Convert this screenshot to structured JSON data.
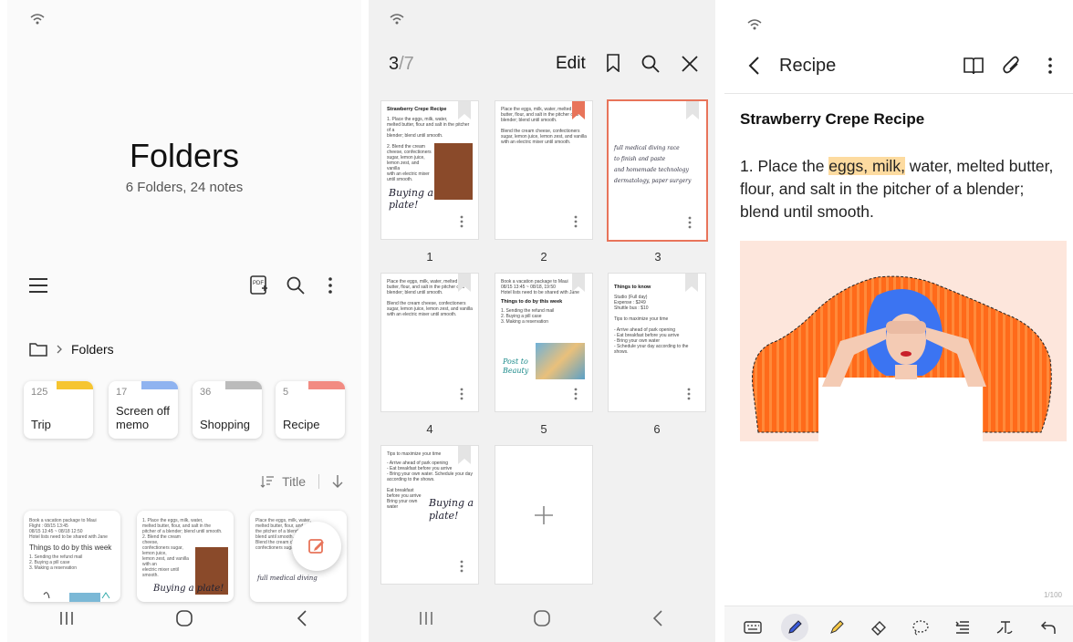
{
  "colors": {
    "accent": "#e8745a",
    "highlight": "#fddba0",
    "folder_trip": "#f6c531",
    "folder_screen_off": "#8fb3f0",
    "folder_shopping": "#bbbbbb",
    "folder_recipe": "#f28b82"
  },
  "folders_panel": {
    "title": "Folders",
    "subtitle": "6 Folders, 24 notes",
    "breadcrumb": "Folders",
    "folders": [
      {
        "count": "125",
        "name": "Trip"
      },
      {
        "count": "17",
        "name": "Screen off memo"
      },
      {
        "count": "36",
        "name": "Shopping"
      },
      {
        "count": "5",
        "name": "Recipe"
      }
    ],
    "sort_label": "Title",
    "notes": [
      {
        "lines": [
          "Book a vacation package to Maui",
          "Flight : 08/15 13:45",
          "08/15 13:45 ~ 08/18 12:50",
          "Hotel lists need to be shared with Jane"
        ],
        "heading": "Things to do by this week",
        "items": [
          "1. Sending the refund mail",
          "2. Buying a pill case",
          "3. Making a reservation"
        ]
      },
      {
        "lines": [
          "1. Place the eggs, milk, water,",
          "melted butter, flour, and salt in the",
          "pitcher of a blender; blend until smooth.",
          "",
          "2. Blend the cream cheese,",
          "confectioners sugar, lemon juice,",
          "lemon zest, and vanilla with an",
          "electric mixer until smooth."
        ],
        "script": "Buying a plate!"
      },
      {
        "lines": [
          "Place the eggs, milk, water,",
          "melted butter, flour, and salt in",
          "the pitcher of a blender;",
          "blend until smooth.",
          "Blend the cream cheese,",
          "confectioners sugar, lemon juice"
        ],
        "script": "full medical diving"
      }
    ]
  },
  "pages_panel": {
    "current": "3",
    "total": "/7",
    "edit_label": "Edit",
    "pages": [
      {
        "num": "1",
        "title": "Strawberry Crepe Recipe",
        "body": [
          "1. Place the eggs, milk, water,",
          "melted butter, flour and salt in the pitcher of a",
          "blender; blend until smooth.",
          "",
          "2. Blend the cream",
          "cheese, confectioners",
          "sugar, lemon juice,",
          "lemon zest, and vanilla",
          "with an electric mixer",
          "until smooth."
        ],
        "script": "Buying a plate!"
      },
      {
        "num": "2",
        "title": "",
        "body": [
          "Place the eggs, milk, water, melted",
          "butter, flour, and salt in the pitcher of a",
          "blender; blend until smooth.",
          "",
          "Blend the cream cheese, confectioners",
          "sugar, lemon juice, lemon zest, and vanilla",
          "with an electric mixer until smooth."
        ]
      },
      {
        "num": "3",
        "title": "",
        "body": [],
        "script_lines": [
          "full medical diving race",
          "to finish and paste",
          "and homemade technology",
          "dermatology, paper surgery"
        ]
      },
      {
        "num": "4",
        "title": "",
        "body": [
          "Place the eggs, milk, water, melted",
          "butter, flour, and salt in the pitcher of a",
          "blender; blend until smooth.",
          "",
          "Blend the cream cheese, confectioners",
          "sugar, lemon juice, lemon zest, and vanilla",
          "with an electric mixer until smooth."
        ]
      },
      {
        "num": "5",
        "title": "",
        "body": [
          "Book a vacation package to Maui",
          "08/15 13:45 ~ 08/18, 19:50",
          "Hotel lists need to be shared with Jane"
        ],
        "heading": "Things to do by this week",
        "items": [
          "1. Sending the refund mail",
          "2. Buying a pill case",
          "3. Making a reservation"
        ],
        "script": "Post to Beauty"
      },
      {
        "num": "6",
        "title": "Things to know",
        "body": [
          "Studio (Full day)",
          "Expense : $249",
          "Shuttle bus : $10",
          "",
          "Tips to maximize your time",
          "",
          "- Arrive ahead of park opening",
          "- Eat breakfast before you arrive",
          "- Bring your own water",
          "- Schedule your day according to the",
          "  shows."
        ]
      },
      {
        "num": "",
        "title": "Tips to maximize your time",
        "body": [
          "- Arrive ahead of park opening",
          "- Eat breakfast before you arrive",
          "- Bring your own water. Schedule your day",
          "  according to the shows.",
          "",
          "Eat breakfast",
          "before you arrive",
          "Bring your own",
          "water"
        ],
        "script": "Buying a plate!"
      }
    ]
  },
  "note_panel": {
    "title": "Recipe",
    "heading": "Strawberry Crepe Recipe",
    "paragraph_prefix": "1. Place the ",
    "paragraph_highlight": "eggs, milk,",
    "paragraph_suffix": " water, melted butter, flour, and salt in the pitcher of a blender; blend until smooth.",
    "page_indicator": "1/100",
    "pen_tools": [
      "keyboard-icon",
      "pen-icon",
      "highlighter-icon",
      "eraser-icon",
      "lasso-icon",
      "text-align-icon",
      "handwriting-text-icon",
      "undo-icon"
    ]
  }
}
